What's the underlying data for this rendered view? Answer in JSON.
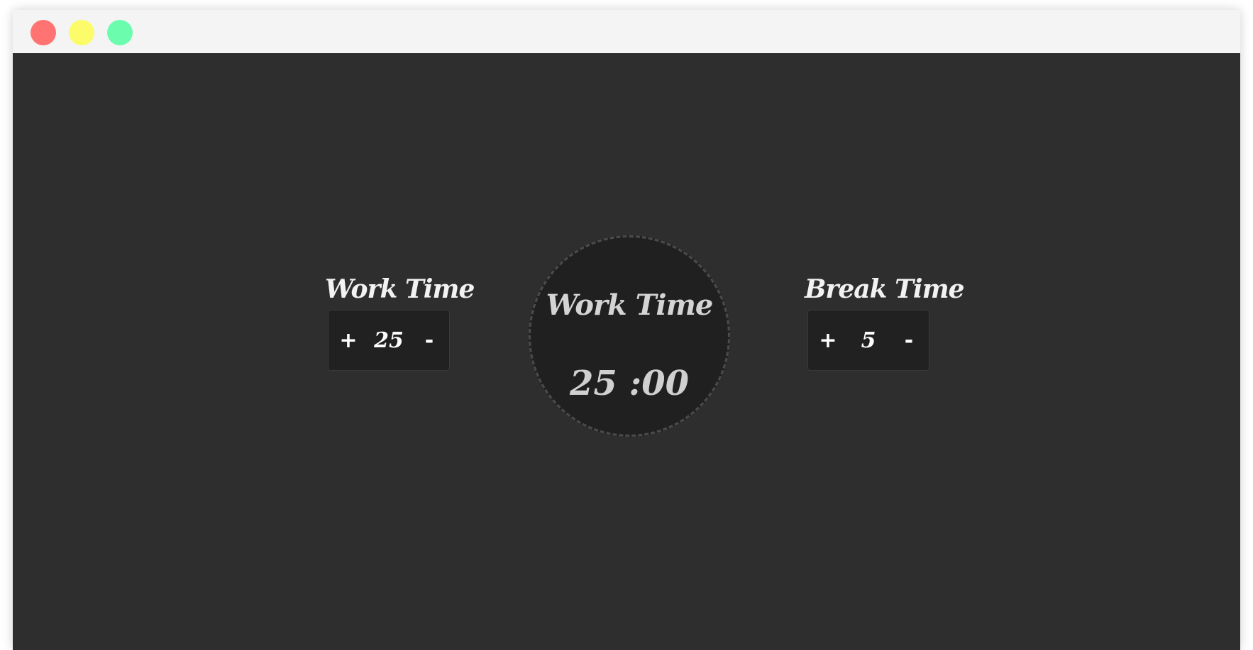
{
  "window": {
    "controls": [
      {
        "name": "close",
        "color": "#ff7373"
      },
      {
        "name": "minimize",
        "color": "#fcfc6a"
      },
      {
        "name": "maximize",
        "color": "#6cfcae"
      }
    ]
  },
  "work_setting": {
    "title": "Work Time",
    "increment_label": "+",
    "value": "25",
    "decrement_label": "-"
  },
  "break_setting": {
    "title": "Break Time",
    "increment_label": "+",
    "value": "5",
    "decrement_label": "-"
  },
  "timer": {
    "label": "Work Time",
    "minutes": "25",
    "separator": " :",
    "seconds": "00"
  },
  "colors": {
    "background": "#2e2e2e",
    "panel": "#212121",
    "titlebar": "#f4f4f4",
    "text": "#f2f2f2"
  }
}
